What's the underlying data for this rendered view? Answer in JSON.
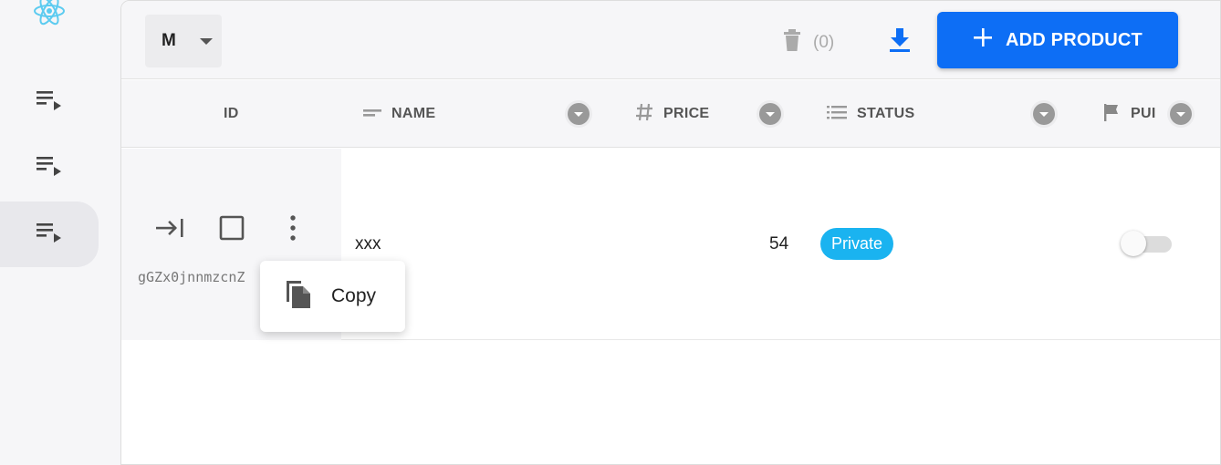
{
  "app": {
    "logo_icon": "react-atom-icon",
    "accent_color": "#0d6ef5"
  },
  "sidebar": {
    "items": [
      {
        "icon": "playlist-play-icon",
        "active": false
      },
      {
        "icon": "playlist-play-icon",
        "active": false
      },
      {
        "icon": "playlist-play-icon",
        "active": true
      }
    ]
  },
  "toolbar": {
    "size_select": {
      "value": "M",
      "icon": "caret-down-icon"
    },
    "delete_count": "(0)",
    "delete_icon": "trash-icon",
    "download_icon": "download-icon",
    "add_label": "ADD PRODUCT",
    "add_icon": "plus-icon"
  },
  "table": {
    "columns": [
      {
        "key": "id",
        "label": "ID",
        "icon": ""
      },
      {
        "key": "name",
        "label": "NAME",
        "icon": "short-text-icon"
      },
      {
        "key": "price",
        "label": "PRICE",
        "icon": "hash-icon"
      },
      {
        "key": "status",
        "label": "STATUS",
        "icon": "list-icon"
      },
      {
        "key": "published",
        "label": "PUI",
        "icon": "flag-icon"
      }
    ],
    "rows": [
      {
        "id": "gGZx0jnnmzcnZ",
        "name": "xxx",
        "price": "54",
        "status": "Private",
        "status_color": "#1ab3f0",
        "published": false
      }
    ]
  },
  "context_menu": {
    "copy_label": "Copy",
    "copy_icon": "copy-icon"
  }
}
